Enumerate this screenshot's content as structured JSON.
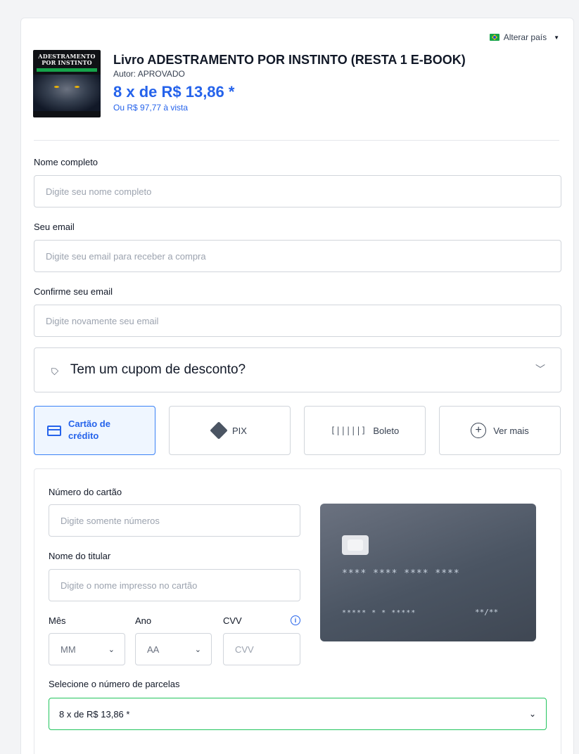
{
  "header": {
    "change_country": "Alterar país"
  },
  "product": {
    "cover": {
      "title_line1": "ADESTRAMENTO",
      "title_line2": "POR INSTINTO"
    },
    "title": "Livro ADESTRAMENTO POR INSTINTO (RESTA 1 E-BOOK)",
    "author": "Autor: APROVADO",
    "price": "8 x de R$ 13,86 *",
    "cash_price": "Ou R$ 97,77 à vista"
  },
  "form": {
    "name_label": "Nome completo",
    "name_placeholder": "Digite seu nome completo",
    "email_label": "Seu email",
    "email_placeholder": "Digite seu email para receber a compra",
    "confirm_email_label": "Confirme seu email",
    "confirm_email_placeholder": "Digite novamente seu email"
  },
  "coupon": {
    "label": "Tem um cupom de desconto?"
  },
  "payment_methods": [
    {
      "label": "Cartão de crédito",
      "active": true
    },
    {
      "label": "PIX",
      "active": false
    },
    {
      "label": "Boleto",
      "active": false
    },
    {
      "label": "Ver mais",
      "active": false
    }
  ],
  "credit_card": {
    "number_label": "Número do cartão",
    "number_placeholder": "Digite somente números",
    "holder_label": "Nome do titular",
    "holder_placeholder": "Digite o nome impresso no cartão",
    "month_label": "Mês",
    "month_value": "MM",
    "year_label": "Ano",
    "year_value": "AA",
    "cvv_label": "CVV",
    "cvv_placeholder": "CVV",
    "installments_label": "Selecione o número de parcelas",
    "installments_value": "8 x de R$ 13,86 *"
  },
  "card_visual": {
    "number": "**** **** **** ****",
    "name": "***** * * *****",
    "expiry": "**/**"
  },
  "colors": {
    "accent": "#2563eb",
    "active_bg": "#eff6ff",
    "select_border": "#22c55e",
    "card_bg": "#4b5563"
  }
}
